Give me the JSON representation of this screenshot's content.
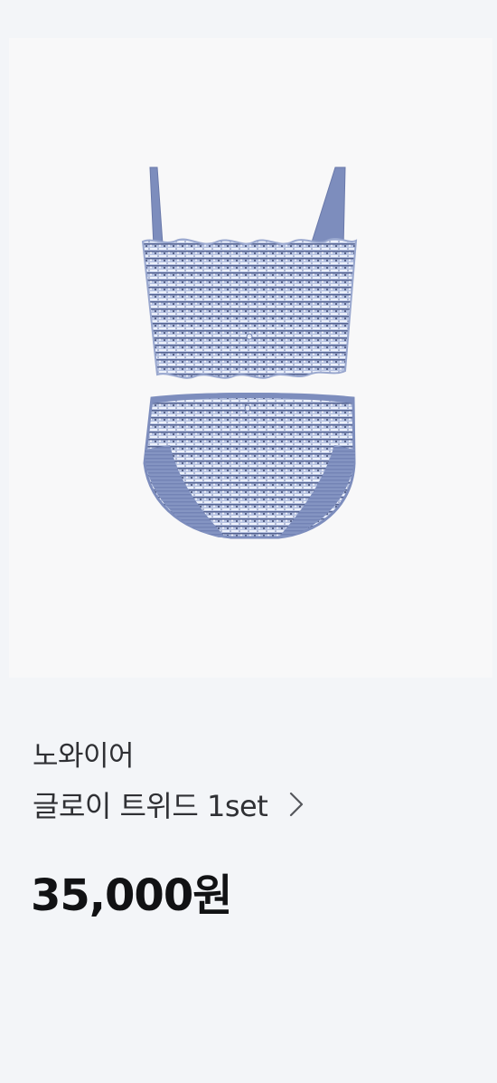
{
  "product": {
    "brand": "노와이어",
    "name": "글로이 트위드 1set",
    "price": "35,000원"
  },
  "icons": {
    "detail": "chevron-right-icon"
  },
  "colors": {
    "page_background": "#f3f5f8",
    "image_background": "#f8f8f9",
    "product_blue": "#7f8fbe",
    "text_primary": "#2f3034",
    "price_text": "#111214"
  }
}
